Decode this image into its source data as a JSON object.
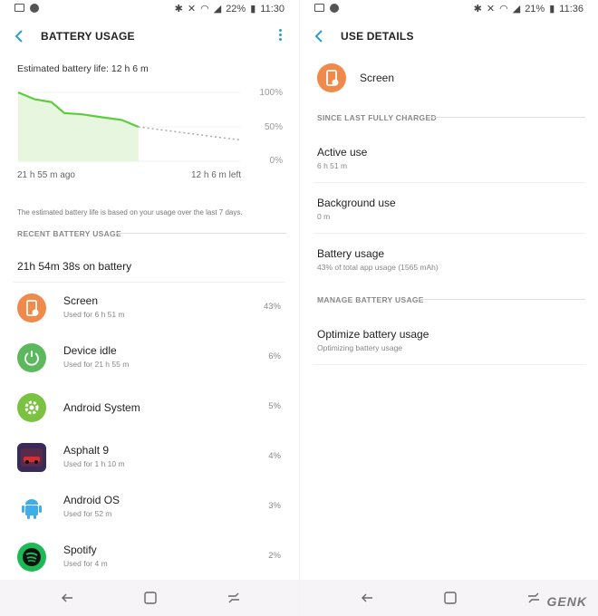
{
  "left": {
    "status": {
      "battery": "22%",
      "time": "11:30"
    },
    "title": "BATTERY USAGE",
    "estimated": "Estimated battery life: 12 h 6 m",
    "chart_data": {
      "type": "line",
      "series": [
        {
          "x": [
            0,
            0.9,
            1.8,
            2.5,
            3.5,
            4.5,
            5.6,
            6.5
          ],
          "values": [
            100,
            90,
            86,
            70,
            68,
            64,
            60,
            50
          ],
          "style": "solid",
          "color": "#5ccd3a"
        },
        {
          "x": [
            6.5,
            8.5,
            10.5,
            12
          ],
          "values": [
            50,
            43,
            36,
            31
          ],
          "style": "dotted",
          "color": "#aaaaaa"
        }
      ],
      "ytick_labels": [
        "100%",
        "50%",
        "0%"
      ],
      "ylim": [
        0,
        100
      ],
      "xtick_labels": [
        "21 h 55 m ago",
        "12 h 6 m left"
      ]
    },
    "note": "The estimated battery life is based on your usage over the last 7 days.",
    "section": "RECENT BATTERY USAGE",
    "total": "21h 54m 38s on battery",
    "apps": [
      {
        "name": "Screen",
        "sub": "Used for 6 h 51 m",
        "pct": "43%",
        "icon": "screen-icon",
        "color": "#f08a4b"
      },
      {
        "name": "Device idle",
        "sub": "Used for 21 h 55 m",
        "pct": "6%",
        "icon": "power-icon",
        "color": "#5cb85c"
      },
      {
        "name": "Android System",
        "sub": "",
        "pct": "5%",
        "icon": "gear-icon",
        "color": "#7cc242"
      },
      {
        "name": "Asphalt 9",
        "sub": "Used for 1 h 10 m",
        "pct": "4%",
        "icon": "asphalt-icon",
        "color": "#3a2a5a"
      },
      {
        "name": "Android OS",
        "sub": "Used for 52 m",
        "pct": "3%",
        "icon": "android-icon",
        "color": "#3daee9"
      },
      {
        "name": "Spotify",
        "sub": "Used for 4 m",
        "pct": "2%",
        "icon": "spotify-icon",
        "color": "#1db954"
      }
    ]
  },
  "right": {
    "status": {
      "battery": "21%",
      "time": "11:36"
    },
    "title": "USE DETAILS",
    "app_name": "Screen",
    "section1": "SINCE LAST FULLY CHARGED",
    "items": [
      {
        "title": "Active use",
        "sub": "6 h 51 m"
      },
      {
        "title": "Background use",
        "sub": "0 m"
      },
      {
        "title": "Battery usage",
        "sub": "43% of total app usage (1565 mAh)"
      }
    ],
    "section2": "MANAGE BATTERY USAGE",
    "optimize": {
      "title": "Optimize battery usage",
      "sub": "Optimizing battery usage"
    }
  },
  "watermark": "GENK"
}
